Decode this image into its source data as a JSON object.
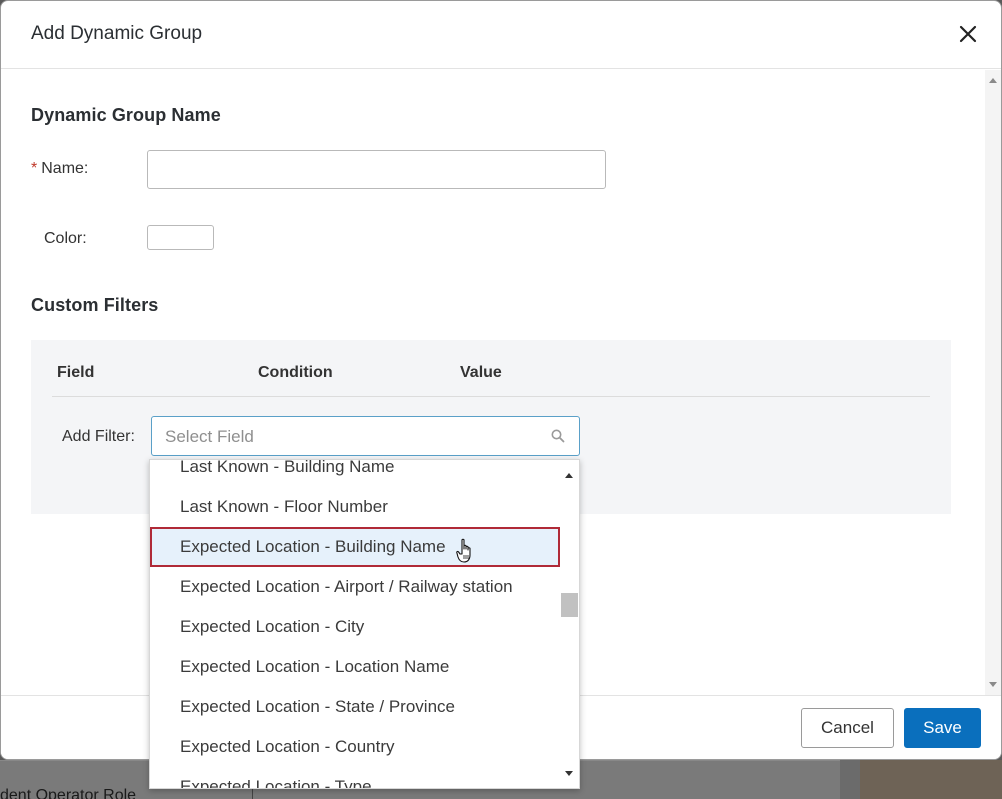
{
  "modal": {
    "title": "Add Dynamic Group",
    "close_icon": "close-icon"
  },
  "group_name_section": {
    "title": "Dynamic Group Name",
    "name_label": "Name",
    "name_required_marker": "*",
    "name_value": "",
    "color_label": "Color",
    "color_value": "#ffffff"
  },
  "filters_section": {
    "title": "Custom Filters",
    "columns": [
      "Field",
      "Condition",
      "Value"
    ],
    "add_filter_label": "Add Filter:",
    "select_placeholder": "Select Field",
    "search_icon": "search-icon"
  },
  "dropdown": {
    "options": [
      "Last Known - Building Name",
      "Last Known - Floor Number",
      "Expected Location - Building Name",
      "Expected Location - Airport / Railway station",
      "Expected Location - City",
      "Expected Location - Location Name",
      "Expected Location - State / Province",
      "Expected Location - Country",
      "Expected Location - Type"
    ],
    "hovered_index": 2
  },
  "footer": {
    "cancel_label": "Cancel",
    "save_label": "Save"
  },
  "background": {
    "partial_text": "dent Operator Role"
  },
  "colors": {
    "primary": "#0a6fbd",
    "highlight_border": "#b02a37",
    "highlight_bg": "#e6f1fb",
    "panel_bg": "#f4f5f7"
  }
}
